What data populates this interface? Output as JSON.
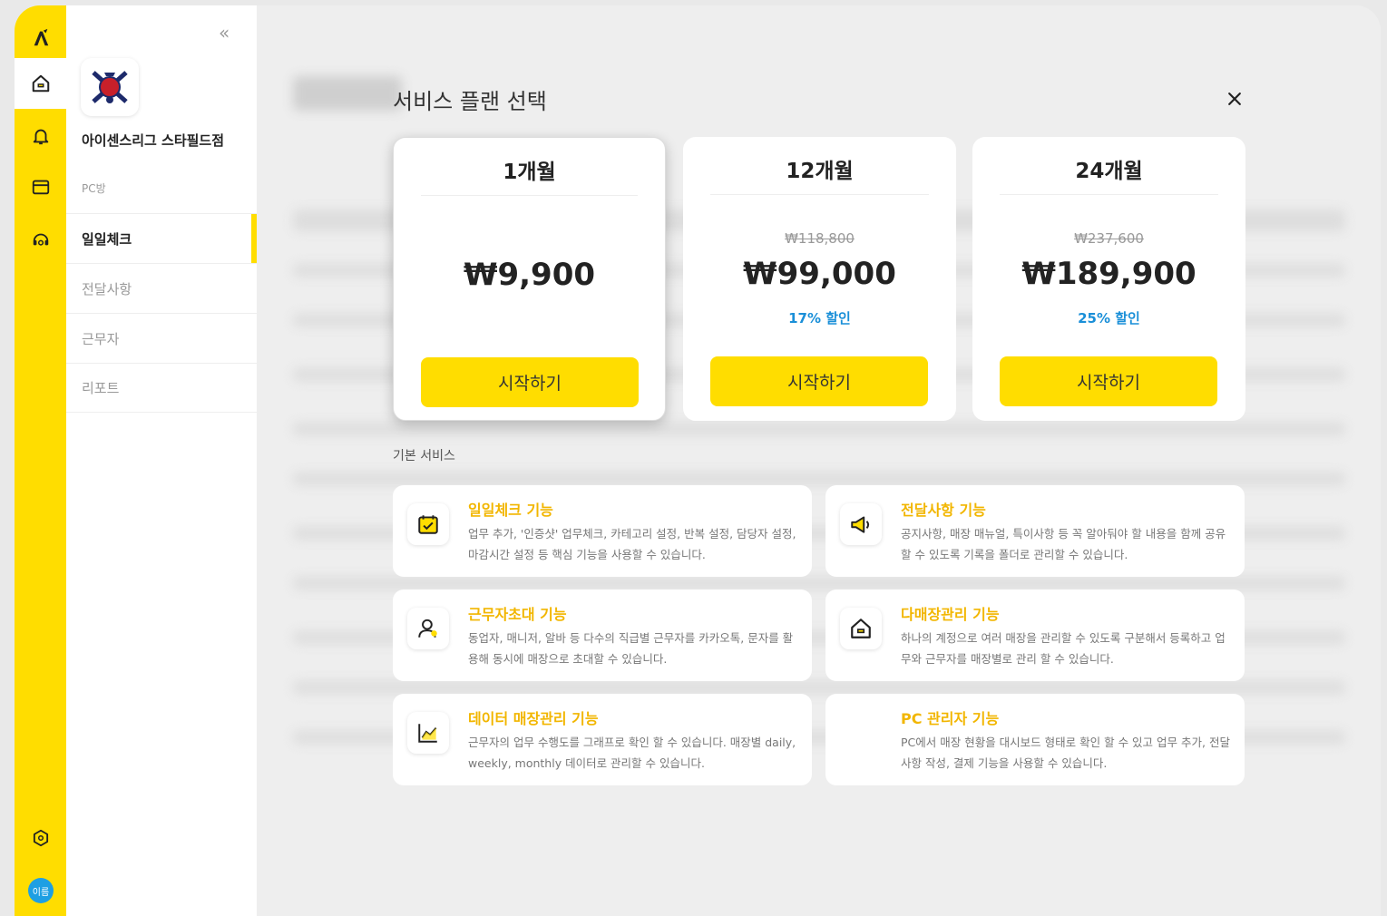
{
  "rail": {
    "logo": "A-logo",
    "items": [
      "home-icon",
      "bell-icon",
      "calendar-icon",
      "support-icon"
    ],
    "settings": "gear-icon",
    "avatar_label": "이름"
  },
  "sidebar": {
    "store_name": "아이센스리그 스타필드점",
    "store_type": "PC방",
    "menu": [
      "일일체크",
      "전달사항",
      "근무자",
      "리포트"
    ]
  },
  "modal": {
    "title": "서비스 플랜 선택",
    "plans": [
      {
        "name": "1개월",
        "original_price": "",
        "price": "₩9,900",
        "discount": "",
        "button": "시작하기"
      },
      {
        "name": "12개월",
        "original_price": "₩118,800",
        "price": "₩99,000",
        "discount": "17% 할인",
        "button": "시작하기"
      },
      {
        "name": "24개월",
        "original_price": "₩237,600",
        "price": "₩189,900",
        "discount": "25% 할인",
        "button": "시작하기"
      }
    ],
    "section_label": "기본 서비스",
    "features": [
      {
        "icon": "calendar-check-icon",
        "title": "일일체크 기능",
        "desc": "업무 추가, '인증샷' 업무체크, 카테고리 설정, 반복 설정, 담당자 설정, 마감시간 설정 등 핵심 기능을 사용할 수 있습니다."
      },
      {
        "icon": "megaphone-icon",
        "title": "전달사항 기능",
        "desc": "공지사항, 매장 매뉴얼, 특이사항 등 꼭 알아둬야 할 내용을 함께 공유할 수 있도록 기록을 폴더로 관리할 수 있습니다."
      },
      {
        "icon": "user-icon",
        "title": "근무자초대 기능",
        "desc": "동업자, 매니저, 알바 등 다수의 직급별 근무자를 카카오톡, 문자를 활용해 동시에 매장으로 초대할 수 있습니다."
      },
      {
        "icon": "store-icon",
        "title": "다매장관리 기능",
        "desc": "하나의 계정으로 여러 매장을 관리할 수 있도록 구분해서 등록하고 업무와 근무자를 매장별로 관리 할 수 있습니다."
      },
      {
        "icon": "chart-icon",
        "title": "데이터 매장관리 기능",
        "desc": "근무자의 업무 수행도를 그래프로 확인 할 수 있습니다. 매장별 daily, weekly, monthly 데이터로 관리할 수 있습니다."
      },
      {
        "icon": "",
        "title": "PC 관리자 기능",
        "desc": "PC에서 매장 현황을 대시보드 형태로 확인 할 수 있고 업무 추가, 전달사항 작성, 결제 기능을 사용할 수 있습니다."
      }
    ]
  },
  "colors": {
    "accent": "#ffdd00",
    "discount": "#1a8fd8",
    "feature_title": "#f2b600",
    "avatar": "#1e9fe3"
  }
}
